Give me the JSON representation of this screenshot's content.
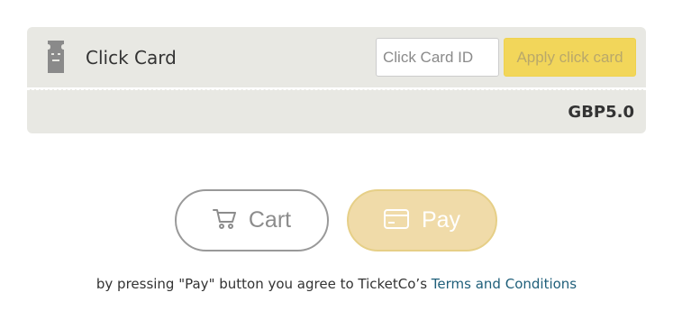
{
  "click_card": {
    "label": "Click Card",
    "input_placeholder": "Click Card ID",
    "input_value": "",
    "apply_label": "Apply click card",
    "icon": "ticket-icon"
  },
  "total": {
    "amount": "GBP5.0"
  },
  "actions": {
    "cart_label": "Cart",
    "cart_icon": "cart-icon",
    "pay_label": "Pay",
    "pay_icon": "credit-card-icon"
  },
  "terms": {
    "text": "by pressing \"Pay\" button you agree to TicketCo’s ",
    "link_text": "Terms and Conditions"
  },
  "colors": {
    "panel_bg": "#e8e8e3",
    "apply_bg": "#f2d65a",
    "pay_bg": "#f0dba9",
    "link": "#1f5f7a"
  }
}
